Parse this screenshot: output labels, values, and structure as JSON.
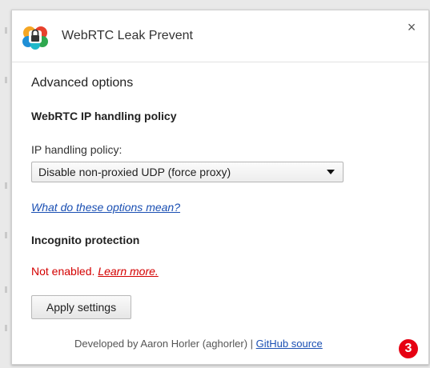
{
  "app": {
    "title": "WebRTC Leak Prevent",
    "close_label": "×"
  },
  "content": {
    "section_title": "Advanced options",
    "policy_heading": "WebRTC IP handling policy",
    "policy_label": "IP handling policy:",
    "policy_selected": "Disable non-proxied UDP (force proxy)",
    "help_link": "What do these options mean?",
    "incognito_heading": "Incognito protection",
    "incognito_status": "Not enabled.",
    "incognito_learn_more": "Learn more.",
    "apply_button": "Apply settings"
  },
  "footer": {
    "developed_by": "Developed by Aaron Horler (aghorler) | ",
    "source_link": "GitHub source"
  },
  "badge": {
    "number": "3",
    "color": "#e60012"
  },
  "icons": {
    "logo": "webrtc-lock-logo-icon",
    "close": "close-icon",
    "dropdown": "chevron-down-icon"
  }
}
